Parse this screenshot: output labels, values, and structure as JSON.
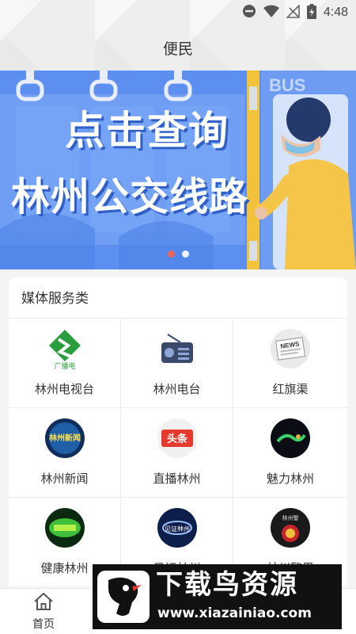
{
  "status_bar": {
    "time": "4:48"
  },
  "header": {
    "title": "便民"
  },
  "banner": {
    "line1": "点击查询",
    "line2": "林州公交线路",
    "bus_text": "BUS",
    "page_count": 2,
    "active_page": 2
  },
  "media_section": {
    "title": "媒体服务类",
    "items": [
      {
        "label": "林州电视台",
        "icon": "tv-station-logo-icon",
        "logo_text": "广播电"
      },
      {
        "label": "林州电台",
        "icon": "radio-icon"
      },
      {
        "label": "红旗渠",
        "icon": "newspaper-icon",
        "logo_text": "NEWS"
      },
      {
        "label": "林州新闻",
        "icon": "linzhou-news-logo-icon",
        "logo_text": "林州新闻"
      },
      {
        "label": "直播林州",
        "icon": "toutiao-logo-icon",
        "logo_text": "头条"
      },
      {
        "label": "魅力林州",
        "icon": "charm-linzhou-logo-icon"
      },
      {
        "label": "健康林州",
        "icon": "health-linzhou-logo-icon"
      },
      {
        "label": "见证林州",
        "icon": "witness-linzhou-logo-icon",
        "logo_text": "见证林州"
      },
      {
        "label": "林州警界",
        "icon": "police-badge-logo-icon",
        "logo_text": "林州警"
      }
    ]
  },
  "bottom_nav": {
    "home_label": "首页"
  },
  "watermark": {
    "title": "下载鸟资源",
    "url": "www.xiazainiao.com"
  },
  "colors": {
    "banner_blue": "#5c8ff0",
    "dot_active": "#f0635a",
    "tv_green": "#2a9d3f"
  }
}
